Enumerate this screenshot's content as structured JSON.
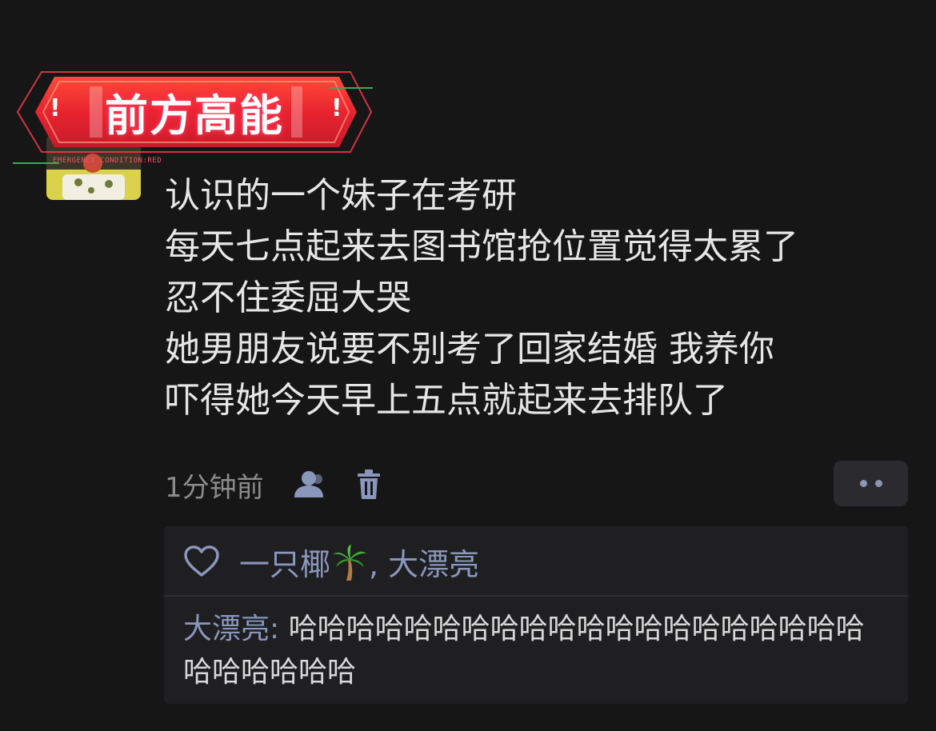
{
  "banner": {
    "title": "前方高能",
    "left_mark": "!",
    "right_mark": "!",
    "subtitle": "EMERGENCY CONDITION:RED"
  },
  "post": {
    "lines": [
      "认识的一个妹子在考研",
      "每天七点起来去图书馆抢位置觉得太累了",
      "忍不住委屈大哭",
      "她男朋友说要不别考了回家结婚 我养你",
      "吓得她今天早上五点就起来去排队了"
    ],
    "time": "1分钟前",
    "icons": {
      "author": "person-icon",
      "delete": "trash-icon",
      "more": "more-dots-icon"
    }
  },
  "reactions": {
    "like_icon": "heart-outline-icon",
    "likers_before": "一只椰",
    "likers_emoji": "palm-tree-emoji",
    "likers_after": ", 大漂亮"
  },
  "comment": {
    "author": "大漂亮",
    "separator": ": ",
    "text": "哈哈哈哈哈哈哈哈哈哈哈哈哈哈哈哈哈哈哈哈哈哈哈哈哈哈"
  },
  "colors": {
    "background": "#161616",
    "text": "#e6e6e6",
    "meta": "#8c8c8c",
    "accent": "#8a97bd",
    "banner_red": "#e8242f"
  }
}
